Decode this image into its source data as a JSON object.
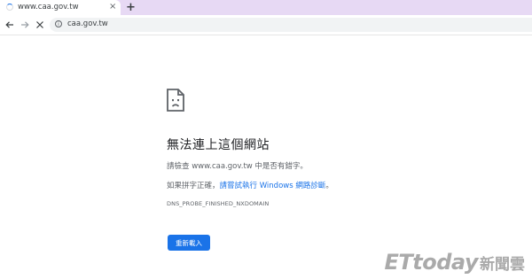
{
  "tab": {
    "title": "www.caa.gov.tw",
    "close": "×"
  },
  "new_tab": "+",
  "omnibox": {
    "url": "caa.gov.tw"
  },
  "error": {
    "title": "無法連上這個網站",
    "line1": "請檢查 www.caa.gov.tw 中是否有錯字。",
    "line2_prefix": "如果拼字正確，",
    "line2_link": "請嘗試執行 Windows 網路診斷",
    "line2_suffix": "。",
    "code": "DNS_PROBE_FINISHED_NXDOMAIN",
    "reload_label": "重新載入"
  },
  "watermark": {
    "latin": "ETtoday",
    "cjk": "新聞雲"
  },
  "colors": {
    "tabstrip": "#e7d9f4",
    "accent": "#1a73e8"
  }
}
